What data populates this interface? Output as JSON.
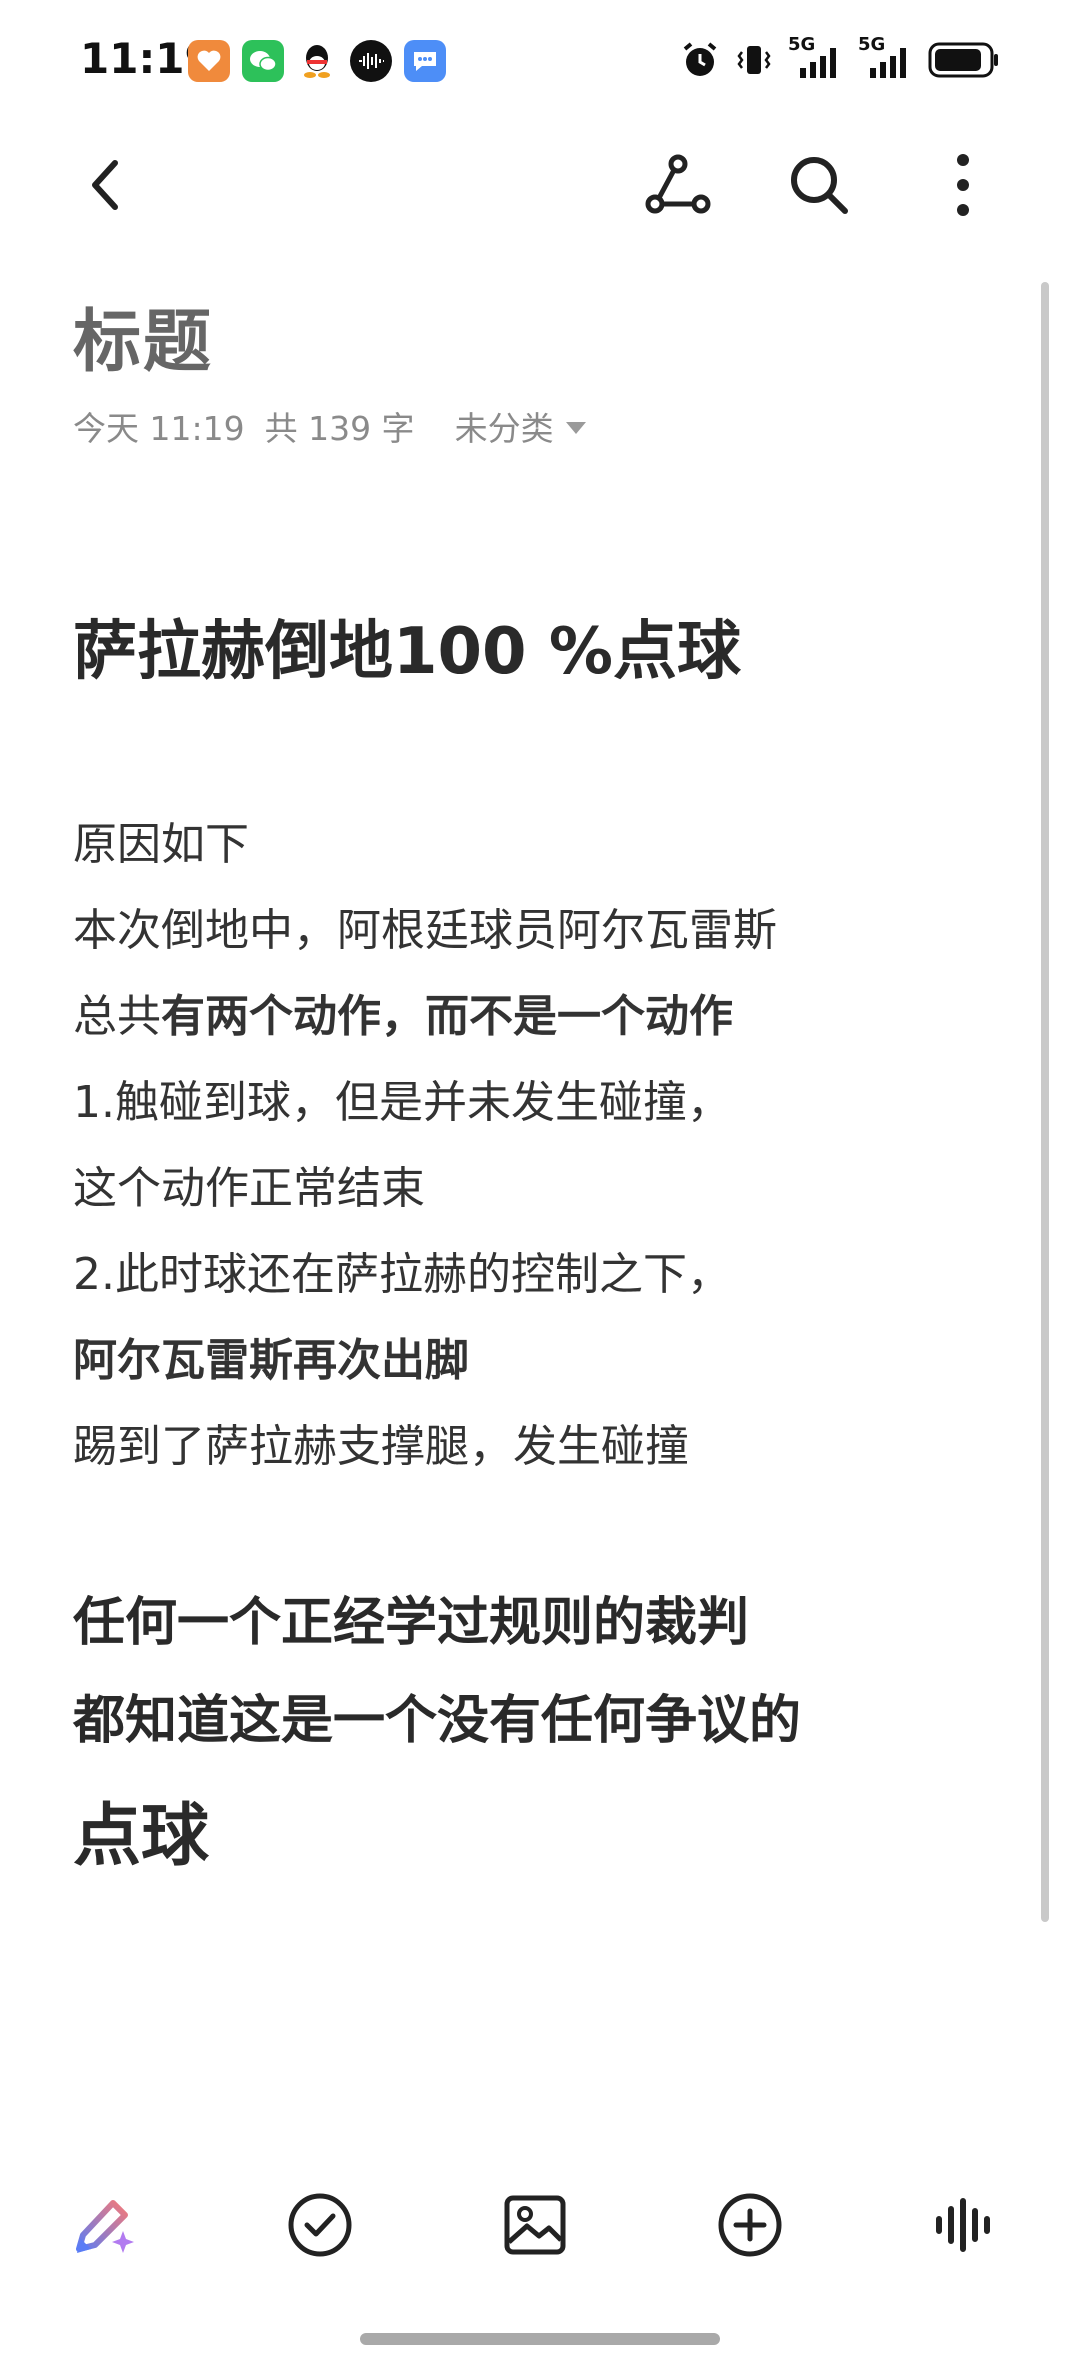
{
  "status_bar": {
    "time": "11:19",
    "network_1": "5G",
    "network_2": "5G"
  },
  "header": {
    "back_icon": "back-chevron-icon",
    "share_icon": "share-icon",
    "search_icon": "search-icon",
    "more_icon": "more-vertical-icon"
  },
  "note": {
    "title": "标题",
    "date": "今天 11:19",
    "count": "共 139 字",
    "category": "未分类",
    "headline": "萨拉赫倒地100 %点球",
    "lines": [
      "原因如下",
      "本次倒地中，阿根廷球员阿尔瓦雷斯",
      "总共",
      "有两个动作，而不是一个动作",
      "1.触碰到球，但是并未发生碰撞，",
      "这个动作正常结束",
      "2.此时球还在萨拉赫的控制之下，",
      "阿尔瓦雷斯再次出脚",
      "踢到了萨拉赫支撑腿，发生碰撞"
    ],
    "emphasis_1": "任何一个正经学过规则的裁判",
    "emphasis_2": "都知道这是一个没有任何争议的",
    "conclusion": "点球"
  },
  "toolbar": {
    "items": [
      "ai-pen-icon",
      "checklist-icon",
      "image-icon",
      "add-icon",
      "voice-icon"
    ]
  }
}
